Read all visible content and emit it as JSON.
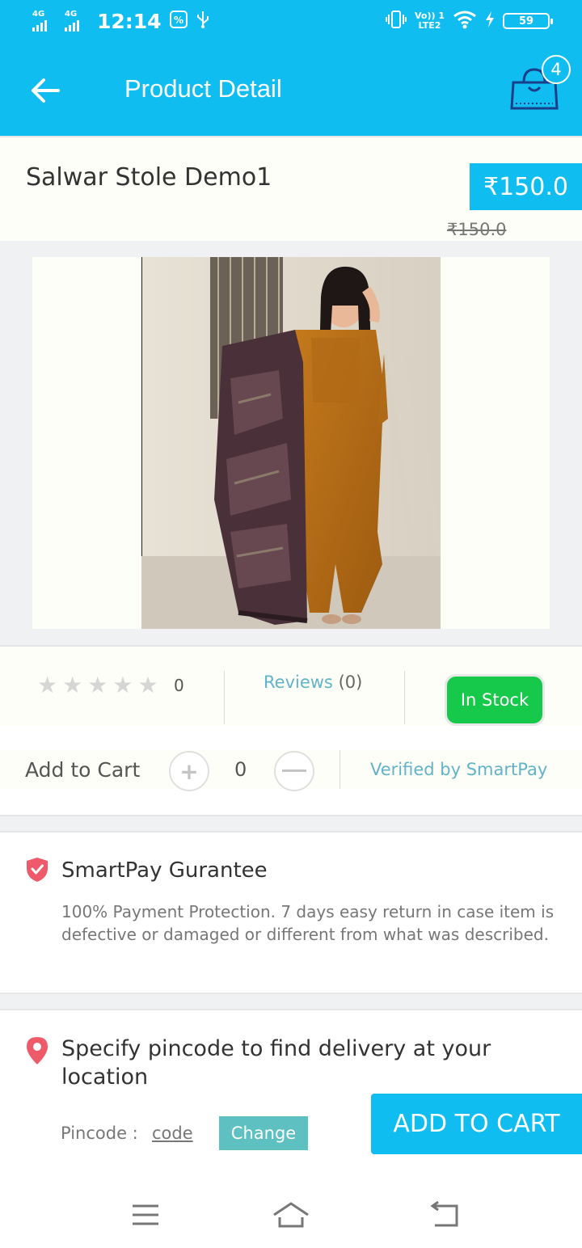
{
  "status_bar": {
    "net1": "4G",
    "net2": "4G",
    "time": "12:14",
    "volte": "Vo)) 1",
    "lte": "LTE2",
    "battery": "59"
  },
  "app_bar": {
    "title": "Product Detail",
    "cart_count": "4"
  },
  "product": {
    "name": "Salwar Stole Demo1",
    "price": "₹150.0",
    "original_price": "₹150.0"
  },
  "info": {
    "rating_count": "0",
    "reviews_label": "Reviews",
    "reviews_count": "(0)",
    "stock_label": "In Stock",
    "rating_stars_filled": 0
  },
  "cart_row": {
    "label": "Add to Cart",
    "plus": "+",
    "quantity": "0",
    "verified": "Verified by SmartPay"
  },
  "guarantee": {
    "title": "SmartPay Gurantee",
    "text": "100% Payment Protection. 7 days easy return in case item is defective or damaged or different from what was described."
  },
  "delivery": {
    "title": "Specify pincode to find delivery at your location",
    "pincode_label": "Pincode :",
    "pincode_value": "code",
    "change_label": "Change"
  },
  "add_to_cart_button": "ADD TO CART",
  "colors": {
    "primary": "#10bdf0",
    "in_stock": "#17c94a",
    "teal_text": "#62b3c8",
    "change_button": "#5ec0c0"
  }
}
